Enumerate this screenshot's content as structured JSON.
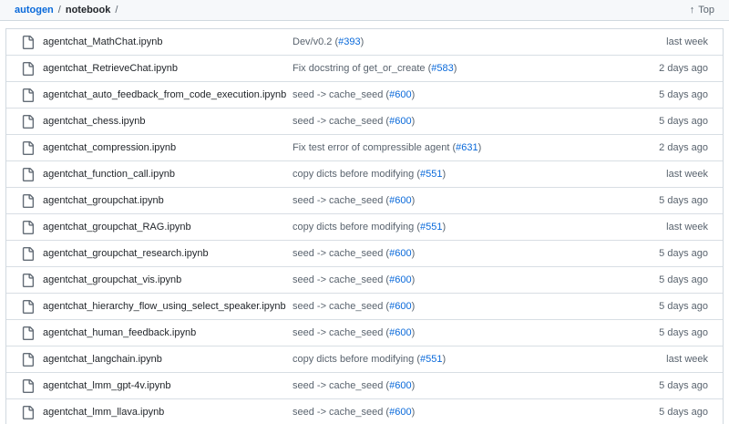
{
  "header": {
    "repo_link": "autogen",
    "separator1": "/",
    "current_dir": "notebook",
    "separator2": "/",
    "top_button": {
      "icon": "↑",
      "label": "Top"
    }
  },
  "colors": {
    "link_blue": "#0969da",
    "text_dark": "#1f2328",
    "text_muted": "#59636e",
    "border": "#d1d9e0",
    "header_bg": "#f6f8fa"
  },
  "icons": {
    "file_icon": "file-document-outline",
    "top_arrow": "↑"
  },
  "files": [
    {
      "name": "agentchat_MathChat.ipynb",
      "message_pre": "Dev/v0.2 (",
      "pr": "#393",
      "message_post": ")",
      "time": "last week"
    },
    {
      "name": "agentchat_RetrieveChat.ipynb",
      "message_pre": "Fix docstring of get_or_create (",
      "pr": "#583",
      "message_post": ")",
      "time": "2 days ago"
    },
    {
      "name": "agentchat_auto_feedback_from_code_execution.ipynb",
      "message_pre": "seed -> cache_seed (",
      "pr": "#600",
      "message_post": ")",
      "time": "5 days ago"
    },
    {
      "name": "agentchat_chess.ipynb",
      "message_pre": "seed -> cache_seed (",
      "pr": "#600",
      "message_post": ")",
      "time": "5 days ago"
    },
    {
      "name": "agentchat_compression.ipynb",
      "message_pre": "Fix test error of compressible agent (",
      "pr": "#631",
      "message_post": ")",
      "time": "2 days ago"
    },
    {
      "name": "agentchat_function_call.ipynb",
      "message_pre": "copy dicts before modifying (",
      "pr": "#551",
      "message_post": ")",
      "time": "last week"
    },
    {
      "name": "agentchat_groupchat.ipynb",
      "message_pre": "seed -> cache_seed (",
      "pr": "#600",
      "message_post": ")",
      "time": "5 days ago"
    },
    {
      "name": "agentchat_groupchat_RAG.ipynb",
      "message_pre": "copy dicts before modifying (",
      "pr": "#551",
      "message_post": ")",
      "time": "last week"
    },
    {
      "name": "agentchat_groupchat_research.ipynb",
      "message_pre": "seed -> cache_seed (",
      "pr": "#600",
      "message_post": ")",
      "time": "5 days ago"
    },
    {
      "name": "agentchat_groupchat_vis.ipynb",
      "message_pre": "seed -> cache_seed (",
      "pr": "#600",
      "message_post": ")",
      "time": "5 days ago"
    },
    {
      "name": "agentchat_hierarchy_flow_using_select_speaker.ipynb",
      "message_pre": "seed -> cache_seed (",
      "pr": "#600",
      "message_post": ")",
      "time": "5 days ago"
    },
    {
      "name": "agentchat_human_feedback.ipynb",
      "message_pre": "seed -> cache_seed (",
      "pr": "#600",
      "message_post": ")",
      "time": "5 days ago"
    },
    {
      "name": "agentchat_langchain.ipynb",
      "message_pre": "copy dicts before modifying (",
      "pr": "#551",
      "message_post": ")",
      "time": "last week"
    },
    {
      "name": "agentchat_lmm_gpt-4v.ipynb",
      "message_pre": "seed -> cache_seed (",
      "pr": "#600",
      "message_post": ")",
      "time": "5 days ago"
    },
    {
      "name": "agentchat_lmm_llava.ipynb",
      "message_pre": "seed -> cache_seed (",
      "pr": "#600",
      "message_post": ")",
      "time": "5 days ago"
    }
  ]
}
